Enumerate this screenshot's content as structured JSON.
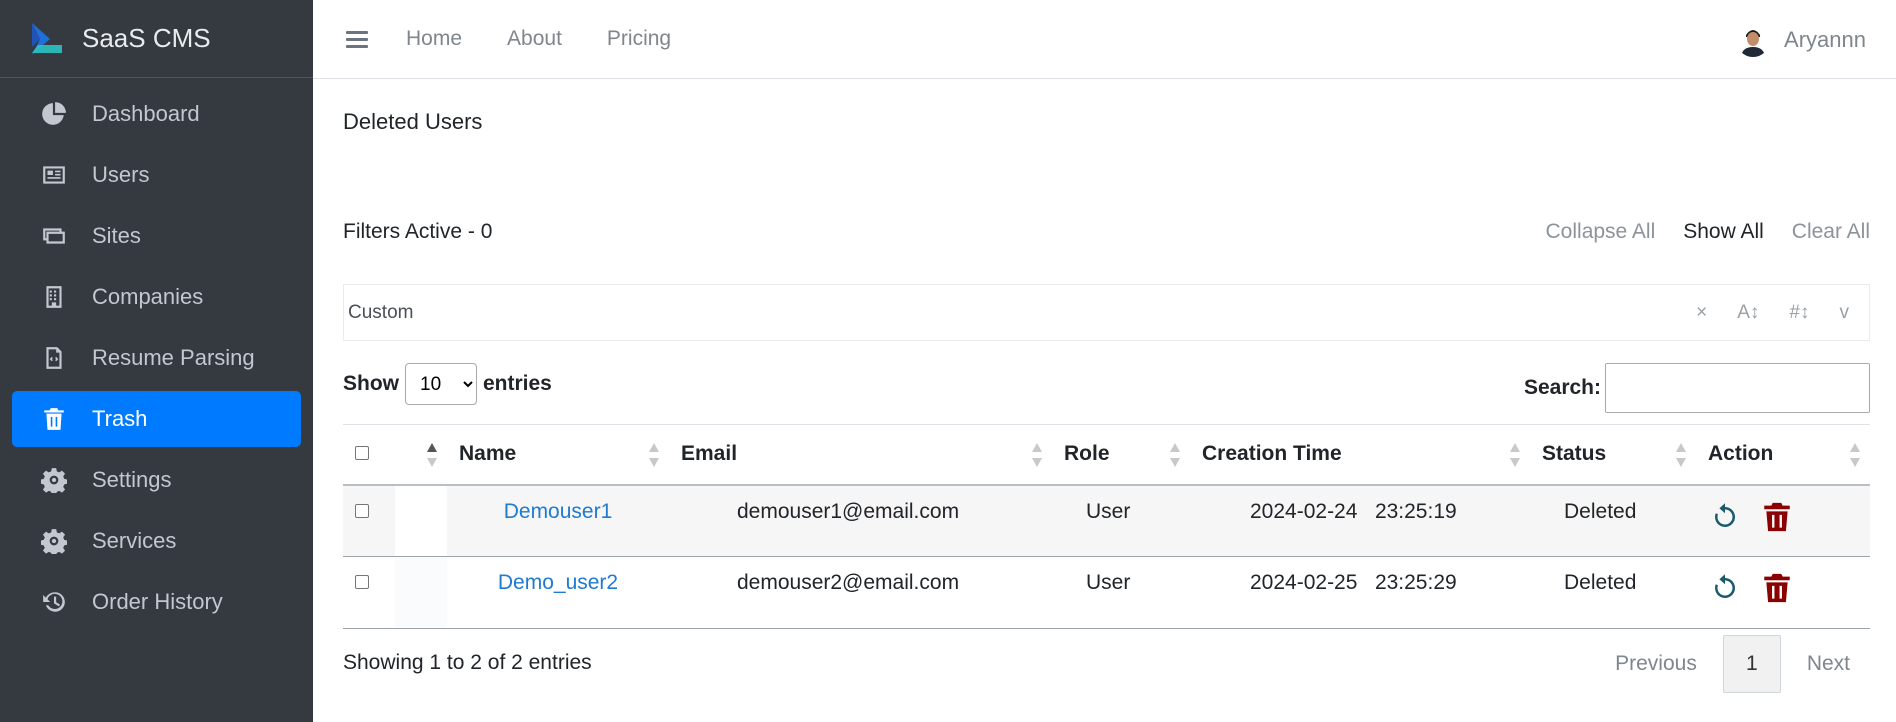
{
  "brand": {
    "name": "SaaS CMS"
  },
  "sidebar": {
    "items": [
      {
        "label": "Dashboard",
        "icon": "pie-chart-icon"
      },
      {
        "label": "Users",
        "icon": "id-card-icon"
      },
      {
        "label": "Sites",
        "icon": "browser-window-icon"
      },
      {
        "label": "Companies",
        "icon": "building-icon"
      },
      {
        "label": "Resume Parsing",
        "icon": "code-file-icon"
      },
      {
        "label": "Trash",
        "icon": "trash-icon",
        "active": true
      },
      {
        "label": "Settings",
        "icon": "gear-icon"
      },
      {
        "label": "Services",
        "icon": "gear-icon"
      },
      {
        "label": "Order History",
        "icon": "history-icon"
      }
    ]
  },
  "topbar": {
    "links": [
      "Home",
      "About",
      "Pricing"
    ],
    "user": "Aryannn"
  },
  "page": {
    "title": "Deleted Users",
    "filters_label": "Filters Active - 0",
    "collapse_all": "Collapse All",
    "show_all": "Show All",
    "clear_all": "Clear All",
    "custom_label": "Custom",
    "custom_tools": {
      "clear": "×",
      "sort_alpha": "A↕",
      "sort_num": "#↕",
      "expand": "v"
    }
  },
  "table_controls": {
    "show": "Show",
    "entries": "entries",
    "entries_value": "10",
    "search_label": "Search:"
  },
  "table": {
    "headers": [
      "Name",
      "Email",
      "Role",
      "Creation Time",
      "Status",
      "Action"
    ],
    "rows": [
      {
        "name": "Demouser1",
        "email": "demouser1@email.com",
        "role": "User",
        "date": "2024-02-24",
        "time": "23:25:19",
        "status": "Deleted"
      },
      {
        "name": "Demo_user2",
        "email": "demouser2@email.com",
        "role": "User",
        "date": "2024-02-25",
        "time": "23:25:29",
        "status": "Deleted"
      }
    ]
  },
  "footer": {
    "showing": "Showing 1 to 2 of 2 entries",
    "previous": "Previous",
    "page": "1",
    "next": "Next"
  },
  "colors": {
    "sidebar_bg": "#343a40",
    "active": "#007bff",
    "link": "#1f7ad1",
    "delete": "#8b0000"
  }
}
